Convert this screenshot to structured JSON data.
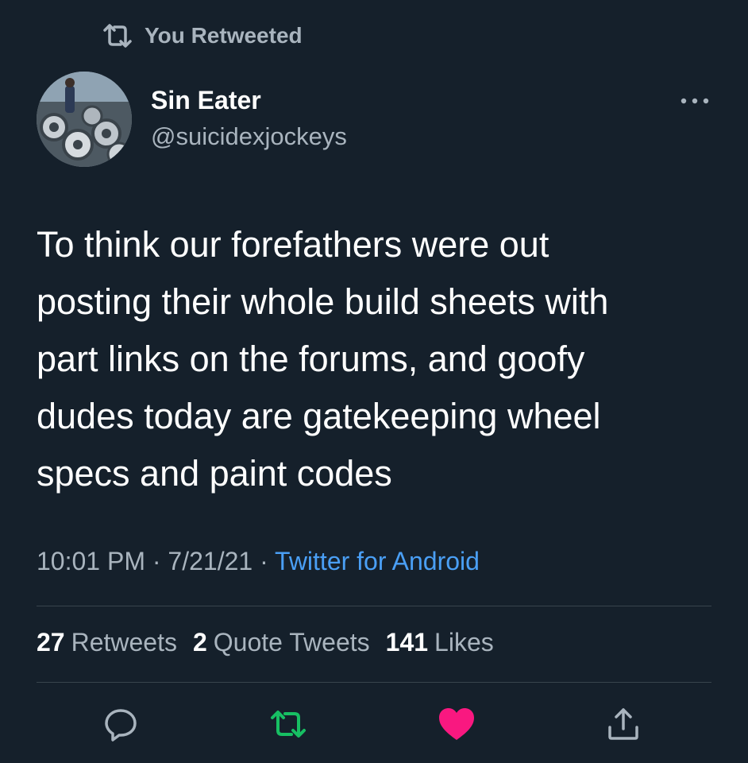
{
  "retweet_context": {
    "label": "You Retweeted",
    "icon": "retweet-icon"
  },
  "author": {
    "name": "Sin Eater",
    "handle": "@suicidexjockeys",
    "avatar": "avatar-photo"
  },
  "tweet": {
    "text": "To think our forefathers were out\nposting their whole build sheets with\npart links on the forums, and goofy\ndudes today are gatekeeping wheel\nspecs and paint codes"
  },
  "meta": {
    "time": "10:01 PM",
    "date": "7/21/21",
    "source": "Twitter for Android",
    "separator": " · "
  },
  "stats": {
    "retweets_count": "27",
    "retweets_label": "Retweets",
    "quotes_count": "2",
    "quotes_label": "Quote Tweets",
    "likes_count": "141",
    "likes_label": "Likes"
  },
  "actions": {
    "reply_icon": "reply-icon",
    "retweet_icon": "retweet-icon",
    "like_icon": "heart-icon",
    "share_icon": "share-icon"
  },
  "colors": {
    "background": "#15202b",
    "secondary_text": "#a9b4be",
    "link": "#4a9ff5",
    "retweet_active": "#17bf63",
    "like_active": "#f91880",
    "divider": "#38444d"
  }
}
